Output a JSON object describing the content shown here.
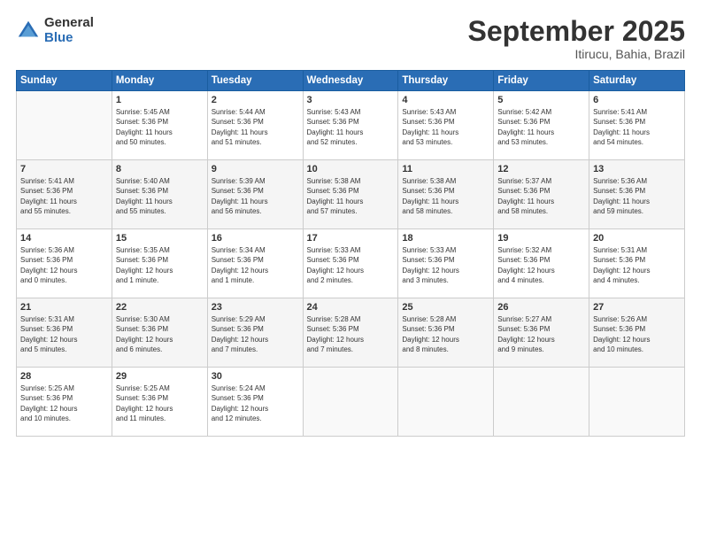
{
  "logo": {
    "general": "General",
    "blue": "Blue"
  },
  "title": "September 2025",
  "subtitle": "Itirucu, Bahia, Brazil",
  "days_of_week": [
    "Sunday",
    "Monday",
    "Tuesday",
    "Wednesday",
    "Thursday",
    "Friday",
    "Saturday"
  ],
  "weeks": [
    [
      {
        "day": "",
        "info": ""
      },
      {
        "day": "1",
        "info": "Sunrise: 5:45 AM\nSunset: 5:36 PM\nDaylight: 11 hours\nand 50 minutes."
      },
      {
        "day": "2",
        "info": "Sunrise: 5:44 AM\nSunset: 5:36 PM\nDaylight: 11 hours\nand 51 minutes."
      },
      {
        "day": "3",
        "info": "Sunrise: 5:43 AM\nSunset: 5:36 PM\nDaylight: 11 hours\nand 52 minutes."
      },
      {
        "day": "4",
        "info": "Sunrise: 5:43 AM\nSunset: 5:36 PM\nDaylight: 11 hours\nand 53 minutes."
      },
      {
        "day": "5",
        "info": "Sunrise: 5:42 AM\nSunset: 5:36 PM\nDaylight: 11 hours\nand 53 minutes."
      },
      {
        "day": "6",
        "info": "Sunrise: 5:41 AM\nSunset: 5:36 PM\nDaylight: 11 hours\nand 54 minutes."
      }
    ],
    [
      {
        "day": "7",
        "info": "Sunrise: 5:41 AM\nSunset: 5:36 PM\nDaylight: 11 hours\nand 55 minutes."
      },
      {
        "day": "8",
        "info": "Sunrise: 5:40 AM\nSunset: 5:36 PM\nDaylight: 11 hours\nand 55 minutes."
      },
      {
        "day": "9",
        "info": "Sunrise: 5:39 AM\nSunset: 5:36 PM\nDaylight: 11 hours\nand 56 minutes."
      },
      {
        "day": "10",
        "info": "Sunrise: 5:38 AM\nSunset: 5:36 PM\nDaylight: 11 hours\nand 57 minutes."
      },
      {
        "day": "11",
        "info": "Sunrise: 5:38 AM\nSunset: 5:36 PM\nDaylight: 11 hours\nand 58 minutes."
      },
      {
        "day": "12",
        "info": "Sunrise: 5:37 AM\nSunset: 5:36 PM\nDaylight: 11 hours\nand 58 minutes."
      },
      {
        "day": "13",
        "info": "Sunrise: 5:36 AM\nSunset: 5:36 PM\nDaylight: 11 hours\nand 59 minutes."
      }
    ],
    [
      {
        "day": "14",
        "info": "Sunrise: 5:36 AM\nSunset: 5:36 PM\nDaylight: 12 hours\nand 0 minutes."
      },
      {
        "day": "15",
        "info": "Sunrise: 5:35 AM\nSunset: 5:36 PM\nDaylight: 12 hours\nand 1 minute."
      },
      {
        "day": "16",
        "info": "Sunrise: 5:34 AM\nSunset: 5:36 PM\nDaylight: 12 hours\nand 1 minute."
      },
      {
        "day": "17",
        "info": "Sunrise: 5:33 AM\nSunset: 5:36 PM\nDaylight: 12 hours\nand 2 minutes."
      },
      {
        "day": "18",
        "info": "Sunrise: 5:33 AM\nSunset: 5:36 PM\nDaylight: 12 hours\nand 3 minutes."
      },
      {
        "day": "19",
        "info": "Sunrise: 5:32 AM\nSunset: 5:36 PM\nDaylight: 12 hours\nand 4 minutes."
      },
      {
        "day": "20",
        "info": "Sunrise: 5:31 AM\nSunset: 5:36 PM\nDaylight: 12 hours\nand 4 minutes."
      }
    ],
    [
      {
        "day": "21",
        "info": "Sunrise: 5:31 AM\nSunset: 5:36 PM\nDaylight: 12 hours\nand 5 minutes."
      },
      {
        "day": "22",
        "info": "Sunrise: 5:30 AM\nSunset: 5:36 PM\nDaylight: 12 hours\nand 6 minutes."
      },
      {
        "day": "23",
        "info": "Sunrise: 5:29 AM\nSunset: 5:36 PM\nDaylight: 12 hours\nand 7 minutes."
      },
      {
        "day": "24",
        "info": "Sunrise: 5:28 AM\nSunset: 5:36 PM\nDaylight: 12 hours\nand 7 minutes."
      },
      {
        "day": "25",
        "info": "Sunrise: 5:28 AM\nSunset: 5:36 PM\nDaylight: 12 hours\nand 8 minutes."
      },
      {
        "day": "26",
        "info": "Sunrise: 5:27 AM\nSunset: 5:36 PM\nDaylight: 12 hours\nand 9 minutes."
      },
      {
        "day": "27",
        "info": "Sunrise: 5:26 AM\nSunset: 5:36 PM\nDaylight: 12 hours\nand 10 minutes."
      }
    ],
    [
      {
        "day": "28",
        "info": "Sunrise: 5:25 AM\nSunset: 5:36 PM\nDaylight: 12 hours\nand 10 minutes."
      },
      {
        "day": "29",
        "info": "Sunrise: 5:25 AM\nSunset: 5:36 PM\nDaylight: 12 hours\nand 11 minutes."
      },
      {
        "day": "30",
        "info": "Sunrise: 5:24 AM\nSunset: 5:36 PM\nDaylight: 12 hours\nand 12 minutes."
      },
      {
        "day": "",
        "info": ""
      },
      {
        "day": "",
        "info": ""
      },
      {
        "day": "",
        "info": ""
      },
      {
        "day": "",
        "info": ""
      }
    ]
  ]
}
